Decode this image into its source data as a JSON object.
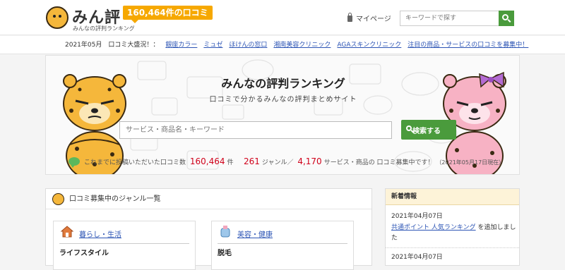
{
  "header": {
    "logo_title": "みん評",
    "logo_sub": "みんなの評判ランキング",
    "count_badge": "160,464件の口コミ",
    "mypage": "マイページ",
    "search_placeholder": "キーワードで探す"
  },
  "campaign": {
    "lead": "2021年05月　口コミ大盛況！：",
    "links": [
      "銀座カラー",
      "ミュゼ",
      "ほけんの窓口",
      "湘南美容クリニック",
      "AGAスキンクリニック",
      "注目の商品・サービスの口コミを募集中！"
    ]
  },
  "hero": {
    "title": "みんなの評判ランキング",
    "subtitle": "口コミで分かるみんなの評判まとめサイト",
    "search_placeholder": "サービス・商品名・キーワード",
    "search_button": "検索する",
    "stats_pre": "これまでに投稿いただいた口コミ数",
    "review_count": "160,464",
    "unit_ken": "件",
    "genre_count": "261",
    "genre_label": "ジャンル／",
    "item_count": "4,170",
    "item_label": "サービス・商品の 口コミ募集中です！",
    "as_of": "（2021年05月17日現在）"
  },
  "genre_panel": {
    "title": "口コミ募集中のジャンル一覧",
    "cards": [
      {
        "category": "暮らし・生活",
        "first_item": "ライフスタイル"
      },
      {
        "category": "美容・健康",
        "first_item": "脱毛"
      }
    ]
  },
  "news": {
    "title": "新着情報",
    "entries": [
      {
        "date": "2021年04月07日",
        "link": "共通ポイント 人気ランキング",
        "text": " を追加しました"
      },
      {
        "date": "2021年04月07日"
      }
    ]
  },
  "colors": {
    "green": "#4a9b3c",
    "orange": "#f6a800",
    "link": "#2d55b5",
    "red": "#d0021b"
  }
}
